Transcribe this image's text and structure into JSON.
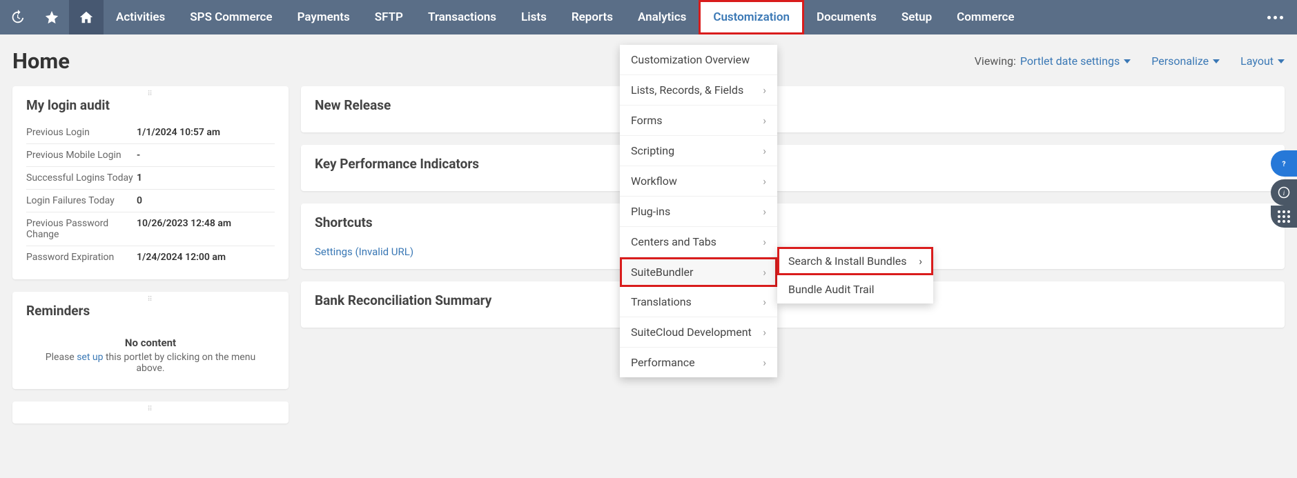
{
  "topbar": {
    "nav": [
      "Activities",
      "SPS Commerce",
      "Payments",
      "SFTP",
      "Transactions",
      "Lists",
      "Reports",
      "Analytics",
      "Customization",
      "Documents",
      "Setup",
      "Commerce"
    ],
    "highlighted_index": 8
  },
  "page": {
    "title": "Home"
  },
  "header_controls": {
    "viewing_prefix": "Viewing:",
    "viewing_value": "Portlet date settings",
    "personalize": "Personalize",
    "layout": "Layout"
  },
  "portlets": {
    "login_audit": {
      "title": "My login audit",
      "rows": [
        {
          "label": "Previous Login",
          "value": "1/1/2024 10:57 am"
        },
        {
          "label": "Previous Mobile Login",
          "value": "-"
        },
        {
          "label": "Successful Logins Today",
          "value": "1"
        },
        {
          "label": "Login Failures Today",
          "value": "0"
        },
        {
          "label": "Previous Password Change",
          "value": "10/26/2023 12:48 am"
        },
        {
          "label": "Password Expiration",
          "value": "1/24/2024 12:00 am"
        }
      ]
    },
    "reminders": {
      "title": "Reminders",
      "no_content_title": "No content",
      "no_content_pre": "Please ",
      "no_content_link": "set up",
      "no_content_post": " this portlet by clicking on the menu above."
    },
    "new_release": {
      "title": "New Release"
    },
    "kpi": {
      "title": "Key Performance Indicators"
    },
    "shortcuts": {
      "title": "Shortcuts",
      "link": "Settings (Invalid URL)"
    },
    "bank": {
      "title": "Bank Reconciliation Summary"
    }
  },
  "dropdown": {
    "items": [
      {
        "label": "Customization Overview",
        "arrow": false
      },
      {
        "label": "Lists, Records, & Fields",
        "arrow": true
      },
      {
        "label": "Forms",
        "arrow": true
      },
      {
        "label": "Scripting",
        "arrow": true
      },
      {
        "label": "Workflow",
        "arrow": true
      },
      {
        "label": "Plug-ins",
        "arrow": true
      },
      {
        "label": "Centers and Tabs",
        "arrow": true
      },
      {
        "label": "SuiteBundler",
        "arrow": true,
        "highlighted": true
      },
      {
        "label": "Translations",
        "arrow": true
      },
      {
        "label": "SuiteCloud Development",
        "arrow": true
      },
      {
        "label": "Performance",
        "arrow": true
      }
    ]
  },
  "submenu": {
    "items": [
      {
        "label": "Search & Install Bundles",
        "arrow": true,
        "highlighted": true
      },
      {
        "label": "Bundle Audit Trail",
        "arrow": false
      }
    ]
  }
}
